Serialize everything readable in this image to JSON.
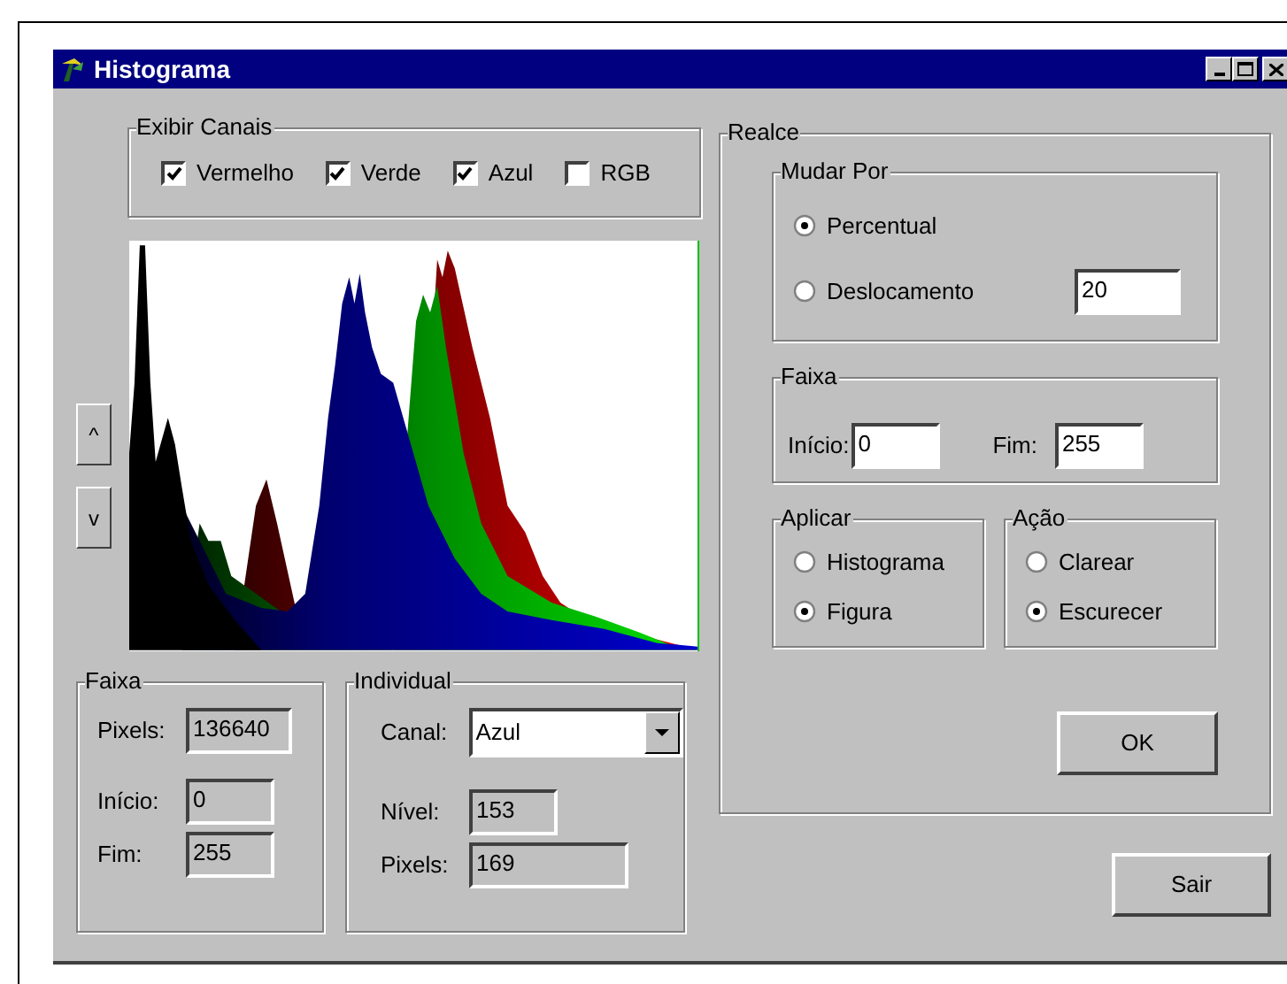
{
  "window": {
    "title": "Histograma"
  },
  "exibir_canais": {
    "label": "Exibir Canais",
    "channels": [
      {
        "label": "Vermelho",
        "checked": true
      },
      {
        "label": "Verde",
        "checked": true
      },
      {
        "label": "Azul",
        "checked": true
      },
      {
        "label": "RGB",
        "checked": false
      }
    ]
  },
  "scroll_buttons": [
    "^",
    "v"
  ],
  "faixa": {
    "label": "Faixa",
    "fields": [
      {
        "label": "Pixels:",
        "value": "136640"
      },
      {
        "label": "Início:",
        "value": "0"
      },
      {
        "label": "Fim:",
        "value": "255"
      }
    ]
  },
  "individual": {
    "label": "Individual",
    "canal": {
      "label": "Canal:",
      "value": "Azul"
    },
    "fields": [
      {
        "label": "Nível:",
        "value": "153"
      },
      {
        "label": "Pixels:",
        "value": "169"
      }
    ]
  },
  "realce": {
    "label": "Realce",
    "mudar_por": {
      "label": "Mudar Por",
      "options": [
        {
          "label": "Percentual",
          "selected": true
        },
        {
          "label": "Deslocamento",
          "selected": false
        }
      ],
      "value": "20"
    },
    "faixa": {
      "label": "Faixa",
      "fields": [
        {
          "label": "Início:",
          "value": "0"
        },
        {
          "label": "Fim:",
          "value": "255"
        }
      ]
    },
    "aplicar": {
      "label": "Aplicar",
      "options": [
        {
          "label": "Histograma",
          "selected": false
        },
        {
          "label": "Figura",
          "selected": true
        }
      ]
    },
    "acao": {
      "label": "Ação",
      "options": [
        {
          "label": "Clarear",
          "selected": false
        },
        {
          "label": "Escurecer",
          "selected": true
        }
      ]
    },
    "ok": "OK"
  },
  "sair": "Sair"
}
